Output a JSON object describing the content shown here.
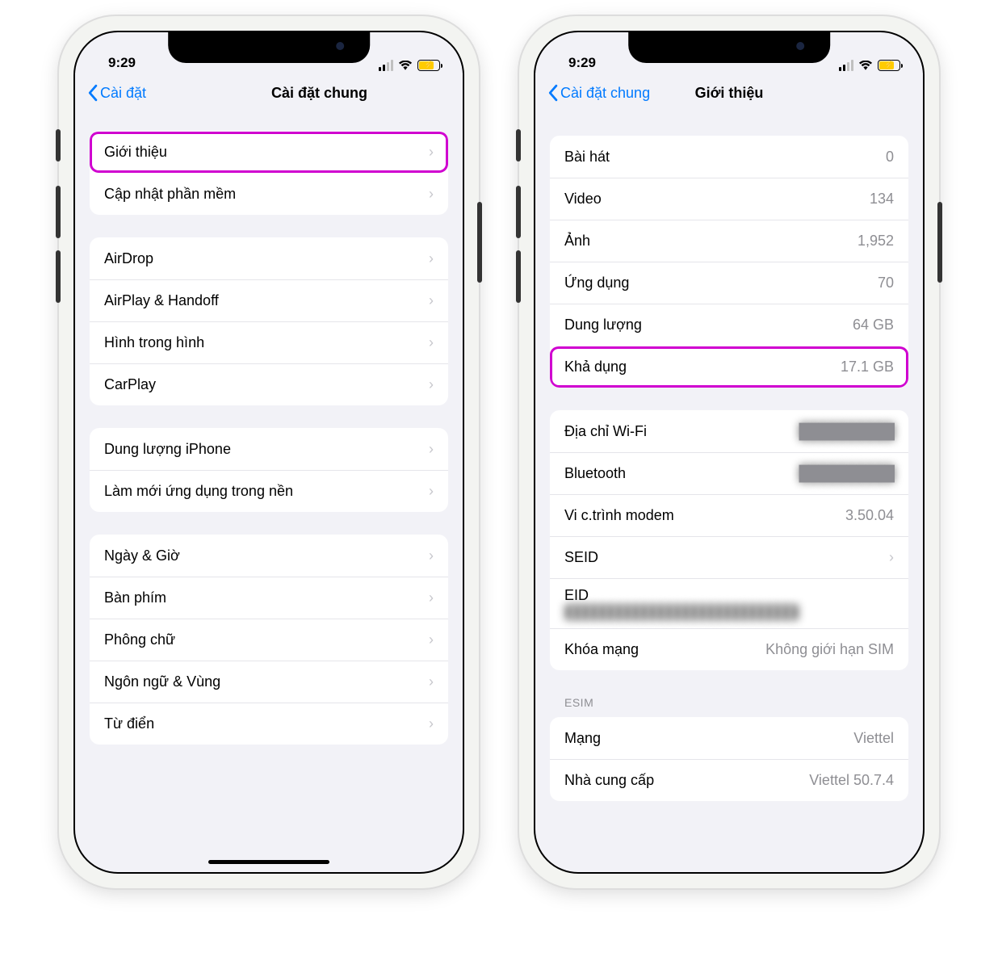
{
  "status": {
    "time": "9:29"
  },
  "phone1": {
    "back_label": "Cài đặt",
    "title": "Cài đặt chung",
    "group1": [
      {
        "label": "Giới thiệu",
        "highlight": true
      },
      {
        "label": "Cập nhật phần mềm"
      }
    ],
    "group2": [
      {
        "label": "AirDrop"
      },
      {
        "label": "AirPlay & Handoff"
      },
      {
        "label": "Hình trong hình"
      },
      {
        "label": "CarPlay"
      }
    ],
    "group3": [
      {
        "label": "Dung lượng iPhone"
      },
      {
        "label": "Làm mới ứng dụng trong nền"
      }
    ],
    "group4": [
      {
        "label": "Ngày & Giờ"
      },
      {
        "label": "Bàn phím"
      },
      {
        "label": "Phông chữ"
      },
      {
        "label": "Ngôn ngữ & Vùng"
      },
      {
        "label": "Từ điển"
      }
    ]
  },
  "phone2": {
    "back_label": "Cài đặt chung",
    "title": "Giới thiệu",
    "group1": [
      {
        "label": "Bài hát",
        "value": "0"
      },
      {
        "label": "Video",
        "value": "134"
      },
      {
        "label": "Ảnh",
        "value": "1,952"
      },
      {
        "label": "Ứng dụng",
        "value": "70"
      },
      {
        "label": "Dung lượng",
        "value": "64 GB"
      },
      {
        "label": "Khả dụng",
        "value": "17.1 GB",
        "highlight": true
      }
    ],
    "group2": {
      "wifi_label": "Địa chỉ Wi-Fi",
      "bt_label": "Bluetooth",
      "modem_label": "Vi c.trình modem",
      "modem_value": "3.50.04",
      "seid_label": "SEID",
      "eid_label": "EID",
      "simlock_label": "Khóa mạng",
      "simlock_value": "Không giới hạn SIM"
    },
    "section_esim": "ESIM",
    "group3": {
      "network_label": "Mạng",
      "network_value": "Viettel",
      "provider_label": "Nhà cung cấp",
      "provider_value": "Viettel 50.7.4"
    }
  }
}
